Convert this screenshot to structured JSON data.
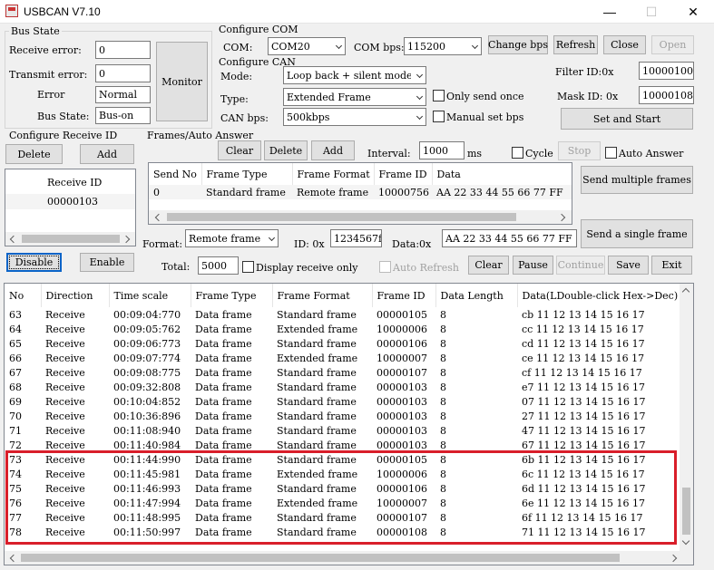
{
  "window": {
    "title": "USBCAN V7.10"
  },
  "bus_state": {
    "group_title": "Bus State",
    "receive_error_label": "Receive error:",
    "receive_error_value": "0",
    "transmit_error_label": "Transmit error:",
    "transmit_error_value": "0",
    "error_label": "Error",
    "error_value": "Normal",
    "bus_state_label": "Bus State:",
    "bus_state_value": "Bus-on",
    "monitor_button": "Monitor"
  },
  "com": {
    "group_title": "Configure COM",
    "com_label": "COM:",
    "com_value": "COM20",
    "bps_label": "COM bps:",
    "bps_value": "115200",
    "change_bps": "Change bps",
    "refresh": "Refresh",
    "close": "Close",
    "open": "Open"
  },
  "can": {
    "group_title": "Configure CAN",
    "mode_label": "Mode:",
    "mode_value": "Loop back + silent mode",
    "type_label": "Type:",
    "type_value": "Extended Frame",
    "bps_label": "CAN bps:",
    "bps_value": "500kbps",
    "only_send_once": "Only send once",
    "manual_set_bps": "Manual set bps",
    "filter_label": "Filter ID:0x",
    "filter_value": "10000100",
    "mask_label": "Mask ID:  0x",
    "mask_value": "10000108",
    "set_and_start": "Set and Start"
  },
  "receive_id": {
    "group_title": "Configure Receive ID",
    "delete": "Delete",
    "add": "Add",
    "header": "Receive ID",
    "items": [
      "00000103"
    ],
    "disable": "Disable",
    "enable": "Enable"
  },
  "frames": {
    "group_title": "Frames/Auto Answer",
    "clear": "Clear",
    "delete": "Delete",
    "add": "Add",
    "interval_label": "Interval:",
    "interval_value": "1000",
    "interval_unit": "ms",
    "cycle": "Cycle",
    "stop": "Stop",
    "auto_answer": "Auto Answer",
    "columns": [
      "Send No",
      "Frame Type",
      "Frame Format",
      "Frame ID",
      "Data"
    ],
    "rows": [
      [
        "0",
        "Standard frame",
        "Remote frame",
        "10000756",
        "AA 22 33 44 55 66 77 FF"
      ]
    ],
    "send_multiple": "Send multiple frames",
    "send_single": "Send a single frame",
    "format_label": "Format:",
    "format_value": "Remote frame",
    "id_label": "ID: 0x",
    "id_value": "1234567f",
    "data_label": "Data:0x",
    "data_value": "AA 22 33 44 55 66 77 FF"
  },
  "controls": {
    "total_label": "Total:",
    "total_value": "5000",
    "display_receive_only": "Display receive only",
    "auto_refresh": "Auto Refresh",
    "clear": "Clear",
    "pause": "Pause",
    "continue": "Continue",
    "save": "Save",
    "exit": "Exit"
  },
  "log": {
    "columns": [
      "No",
      "Direction",
      "Time scale",
      "Frame Type",
      "Frame Format",
      "Frame ID",
      "Data Length",
      "Data(LDouble-click Hex->Dec)"
    ],
    "rows": [
      [
        "63",
        "Receive",
        "00:09:04:770",
        "Data frame",
        "Standard frame",
        "00000105",
        "8",
        "cb 11 12 13 14 15 16 17"
      ],
      [
        "64",
        "Receive",
        "00:09:05:762",
        "Data frame",
        "Extended frame",
        "10000006",
        "8",
        "cc 11 12 13 14 15 16 17"
      ],
      [
        "65",
        "Receive",
        "00:09:06:773",
        "Data frame",
        "Standard frame",
        "00000106",
        "8",
        "cd 11 12 13 14 15 16 17"
      ],
      [
        "66",
        "Receive",
        "00:09:07:774",
        "Data frame",
        "Extended frame",
        "10000007",
        "8",
        "ce 11 12 13 14 15 16 17"
      ],
      [
        "67",
        "Receive",
        "00:09:08:775",
        "Data frame",
        "Standard frame",
        "00000107",
        "8",
        "cf 11 12 13 14 15 16 17"
      ],
      [
        "68",
        "Receive",
        "00:09:32:808",
        "Data frame",
        "Standard frame",
        "00000103",
        "8",
        "e7 11 12 13 14 15 16 17"
      ],
      [
        "69",
        "Receive",
        "00:10:04:852",
        "Data frame",
        "Standard frame",
        "00000103",
        "8",
        "07 11 12 13 14 15 16 17"
      ],
      [
        "70",
        "Receive",
        "00:10:36:896",
        "Data frame",
        "Standard frame",
        "00000103",
        "8",
        "27 11 12 13 14 15 16 17"
      ],
      [
        "71",
        "Receive",
        "00:11:08:940",
        "Data frame",
        "Standard frame",
        "00000103",
        "8",
        "47 11 12 13 14 15 16 17"
      ],
      [
        "72",
        "Receive",
        "00:11:40:984",
        "Data frame",
        "Standard frame",
        "00000103",
        "8",
        "67 11 12 13 14 15 16 17"
      ],
      [
        "73",
        "Receive",
        "00:11:44:990",
        "Data frame",
        "Standard frame",
        "00000105",
        "8",
        "6b 11 12 13 14 15 16 17"
      ],
      [
        "74",
        "Receive",
        "00:11:45:981",
        "Data frame",
        "Extended frame",
        "10000006",
        "8",
        "6c 11 12 13 14 15 16 17"
      ],
      [
        "75",
        "Receive",
        "00:11:46:993",
        "Data frame",
        "Standard frame",
        "00000106",
        "8",
        "6d 11 12 13 14 15 16 17"
      ],
      [
        "76",
        "Receive",
        "00:11:47:994",
        "Data frame",
        "Extended frame",
        "10000007",
        "8",
        "6e 11 12 13 14 15 16 17"
      ],
      [
        "77",
        "Receive",
        "00:11:48:995",
        "Data frame",
        "Standard frame",
        "00000107",
        "8",
        "6f 11 12 13 14 15 16 17"
      ],
      [
        "78",
        "Receive",
        "00:11:50:997",
        "Data frame",
        "Standard frame",
        "00000108",
        "8",
        "71 11 12 13 14 15 16 17"
      ]
    ]
  }
}
